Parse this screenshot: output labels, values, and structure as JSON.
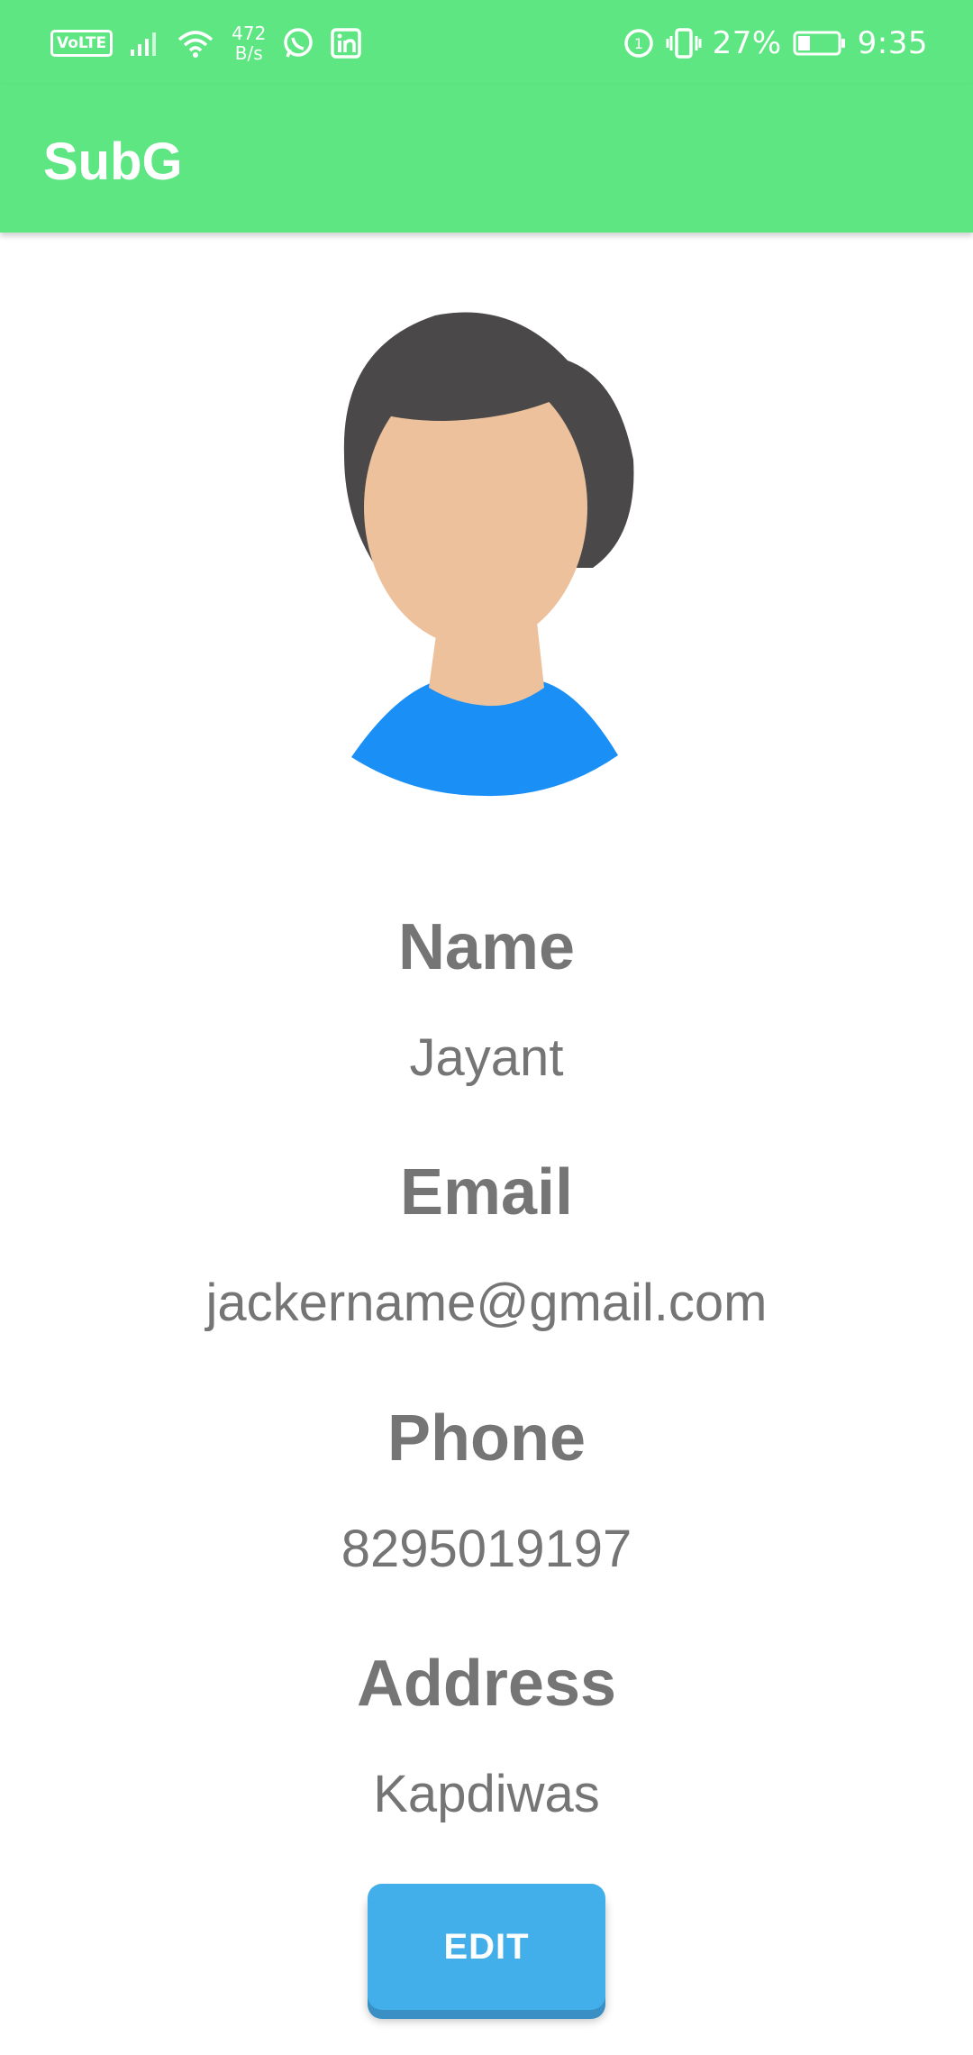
{
  "status_bar": {
    "volte": "VoLTE",
    "net_speed_value": "472",
    "net_speed_unit": "B/s",
    "battery_percent": "27%",
    "time": "9:35",
    "icons": [
      "signal-icon",
      "wifi-icon",
      "whatsapp-icon",
      "linkedin-icon",
      "data-saver-icon",
      "vibrate-icon",
      "battery-icon"
    ]
  },
  "app_bar": {
    "title": "SubG"
  },
  "profile": {
    "fields": [
      {
        "label": "Name",
        "value": "Jayant"
      },
      {
        "label": "Email",
        "value": "jackername@gmail.com"
      },
      {
        "label": "Phone",
        "value": "8295019197"
      },
      {
        "label": "Address",
        "value": "Kapdiwas"
      }
    ],
    "edit_label": "EDIT"
  },
  "colors": {
    "primary": "#5de681",
    "button": "#42aeea",
    "text": "#757575",
    "avatar_hair": "#4a4848",
    "avatar_skin": "#ecc19c",
    "avatar_shirt": "#1a8ff5"
  }
}
